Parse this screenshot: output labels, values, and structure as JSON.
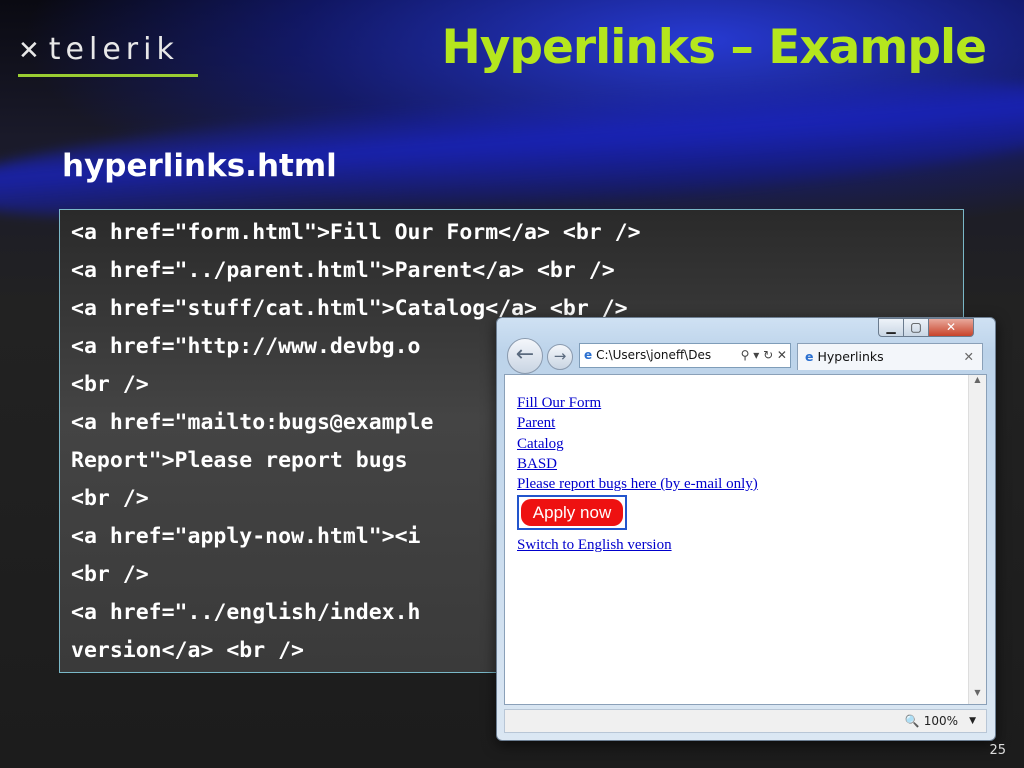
{
  "logo": {
    "mark": "✕",
    "text": "telerik"
  },
  "slide": {
    "title": "Hyperlinks – Example",
    "subtitle": "hyperlinks.html",
    "page_number": "25"
  },
  "code_lines": [
    "<a href=\"form.html\">Fill Our Form</a> <br />",
    "<a href=\"../parent.html\">Parent</a> <br />",
    "<a href=\"stuff/cat.html\">Catalog</a> <br />",
    "<a href=\"http://www.devbg.o",
    "<br />",
    "<a href=\"mailto:bugs@example",
    "Report\">Please report bugs",
    "<br />",
    "<a href=\"apply-now.html\"><i",
    "<br />",
    "<a href=\"../english/index.h",
    "version</a> <br />"
  ],
  "browser": {
    "window_controls": {
      "minimize": "▁",
      "maximize": "▢",
      "close": "✕"
    },
    "back_icon": "←",
    "forward_icon": "→",
    "address": "C:\\Users\\joneff\\Des",
    "address_tools": "⚲ ▾ ↻ ✕",
    "tab_title": "Hyperlinks",
    "tab_close": "✕",
    "links": [
      "Fill Our Form",
      "Parent",
      "Catalog",
      "BASD",
      "Please report bugs here (by e-mail only)"
    ],
    "apply_button": "Apply now",
    "switch_link": "Switch to English version",
    "zoom": "100%",
    "zoom_arrow": "▼",
    "scroll_up": "▲",
    "scroll_down": "▼"
  }
}
